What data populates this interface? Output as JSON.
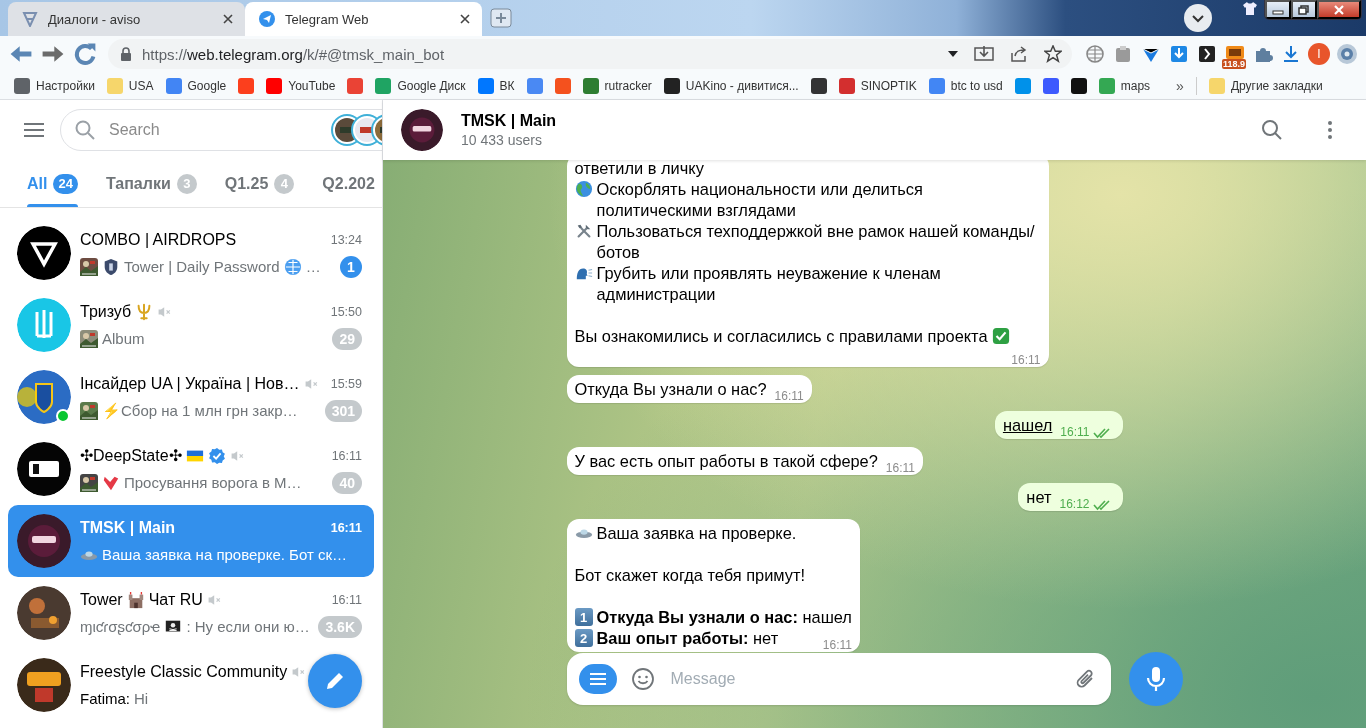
{
  "browser": {
    "tabs": [
      {
        "title": "Диалоги - aviso",
        "selected": false
      },
      {
        "title": "Telegram Web",
        "selected": true
      }
    ],
    "url": {
      "scheme": "https://",
      "host": "web.telegram.org",
      "path": "/k/#@tmsk_main_bot"
    },
    "extension_badge": "118.9",
    "profile_initial": "I",
    "bookmarks": [
      {
        "label": "Настройки",
        "color": "#5f6368"
      },
      {
        "label": "USA",
        "color": "#f6d66b"
      },
      {
        "label": "Google",
        "color": "#4285f4"
      },
      {
        "color": "#fc3f1d"
      },
      {
        "label": "YouTube",
        "color": "#ff0000"
      },
      {
        "color": "#ea4335"
      },
      {
        "label": "Google Диск",
        "color": "#1fa463"
      },
      {
        "label": "ВК",
        "color": "#0077ff"
      },
      {
        "color": "#4a89f3"
      },
      {
        "color": "#f4511e"
      },
      {
        "label": "rutracker",
        "color": "#2e7d32"
      },
      {
        "label": "UAKino - дивитися...",
        "color": "#222222"
      },
      {
        "color": "#333334"
      },
      {
        "label": "SINOPTIK",
        "color": "#d32f2f"
      },
      {
        "label": "btc to usd",
        "color": "#4286f4"
      },
      {
        "color": "#0091ea"
      },
      {
        "color": "#3d5afe"
      },
      {
        "color": "#111111"
      },
      {
        "label": "maps",
        "color": "#34a853"
      }
    ],
    "overflow": "»",
    "other_bookmarks": "Другие закладки"
  },
  "sidebar": {
    "search": {
      "placeholder": "Search"
    },
    "folders": [
      {
        "label": "All",
        "count": "24",
        "selected": true
      },
      {
        "label": "Тапалки",
        "count": "3",
        "selected": false
      },
      {
        "label": "Q1.25",
        "count": "4",
        "selected": false
      },
      {
        "label": "Q2.202",
        "selected": false
      }
    ],
    "chats": [
      {
        "name": [
          {
            "kind": "text",
            "text": "COMBO | AIRDROPS"
          }
        ],
        "muted": false,
        "verified": false,
        "online": false,
        "time": "13:24",
        "preview": [
          {
            "kind": "thumb"
          },
          {
            "kind": "icon"
          },
          {
            "kind": "text",
            "text": "Tower | Daily Password"
          },
          {
            "kind": "icon"
          },
          {
            "kind": "text",
            "text": "…"
          }
        ],
        "badge": "1",
        "selected": false,
        "color": "#000000"
      },
      {
        "name": [
          {
            "kind": "text",
            "text": "Тризуб"
          },
          {
            "kind": "icon"
          }
        ],
        "muted": true,
        "verified": false,
        "online": false,
        "time": "15:50",
        "preview": [
          {
            "kind": "thumb"
          },
          {
            "kind": "text",
            "text": "Album"
          }
        ],
        "badge": "29",
        "selected": false,
        "color": "#19c6e6"
      },
      {
        "name": [
          {
            "kind": "text",
            "text": "Інсайдер UA | Україна | Нов…"
          }
        ],
        "muted": true,
        "verified": false,
        "online": true,
        "time": "15:59",
        "preview": [
          {
            "kind": "thumb"
          },
          {
            "kind": "text",
            "text": "⚡Сбор на 1 млн грн закр…"
          }
        ],
        "badge": "301",
        "selected": false,
        "color": "#2b6cc4"
      },
      {
        "name": [
          {
            "kind": "text",
            "text": "✣DeepState✣"
          },
          {
            "kind": "icon"
          }
        ],
        "muted": true,
        "verified": true,
        "online": false,
        "time": "16:11",
        "preview": [
          {
            "kind": "thumb"
          },
          {
            "kind": "icon"
          },
          {
            "kind": "text",
            "text": "Просування ворога в М…"
          }
        ],
        "badge": "40",
        "selected": false,
        "color": "#050505"
      },
      {
        "name": [
          {
            "kind": "text",
            "text": "TMSK | Main"
          }
        ],
        "muted": false,
        "verified": false,
        "online": false,
        "time": "16:11",
        "preview": [
          {
            "kind": "icon"
          },
          {
            "kind": "text",
            "text": "Ваша заявка на проверке. Бот ск…"
          }
        ],
        "selected": true,
        "color": "#3a1a2a"
      },
      {
        "name": [
          {
            "kind": "text",
            "text": "Tower"
          },
          {
            "kind": "icon"
          },
          {
            "kind": "text",
            "text": "Чат RU"
          }
        ],
        "muted": true,
        "verified": false,
        "online": false,
        "time": "16:11",
        "preview": [
          {
            "kind": "text",
            "text": "ɱιƈɾσʂƈσρҽ"
          },
          {
            "kind": "icon"
          },
          {
            "kind": "text",
            "text": ": Ну если они ю…"
          }
        ],
        "badge": "3.6K",
        "selected": false,
        "color": "#4a3a30"
      },
      {
        "name": [
          {
            "kind": "text",
            "text": "Freestyle Classic Community"
          }
        ],
        "muted": true,
        "verified": false,
        "online": false,
        "preview": [
          {
            "kind": "sender",
            "text": "Fatima:"
          },
          {
            "kind": "text",
            "text": "Hi"
          }
        ],
        "selected": false,
        "color": "#3a2a1a"
      }
    ]
  },
  "chat": {
    "title": "TMSK | Main",
    "subtitle": "10 433 users",
    "messages": [
      {
        "kind": "in",
        "paragraphs": [
          {
            "kind": "plain",
            "text": "ответили в личку"
          },
          {
            "kind": "emoji",
            "text": "Оскорблять национальности или делиться политическими взглядами"
          },
          {
            "kind": "emoji",
            "text": "Пользоваться техподдержкой вне рамок нашей команды/ботов"
          },
          {
            "kind": "emoji",
            "text": "Грубить или проявлять неуважение к членам администрации"
          },
          {
            "kind": "emoji_after",
            "spaced": true,
            "text": "Вы ознакомились и согласились с правилами проекта"
          }
        ],
        "time": "16:11"
      },
      {
        "kind": "in",
        "paragraphs": [
          {
            "kind": "plain",
            "text": "Откуда Вы узнали о нас?"
          }
        ],
        "time": "16:11"
      },
      {
        "kind": "out",
        "underlined": true,
        "paragraphs": [
          {
            "kind": "plain",
            "text": "нашел"
          }
        ],
        "time": "16:11",
        "read": true
      },
      {
        "kind": "in",
        "paragraphs": [
          {
            "kind": "plain",
            "text": "У вас есть опыт работы в такой сфере?"
          }
        ],
        "time": "16:11"
      },
      {
        "kind": "out",
        "underlined": false,
        "paragraphs": [
          {
            "kind": "plain",
            "text": "нет"
          }
        ],
        "time": "16:12",
        "read": true
      },
      {
        "kind": "in",
        "paragraphs": [
          {
            "kind": "emoji",
            "text": "Ваша заявка на проверке."
          },
          {
            "kind": "plain",
            "spaced": true,
            "text": "Бот скажет когда тебя примут!"
          },
          {
            "kind": "keycap",
            "spaced": true,
            "keycap": "1",
            "text": "**Откуда Вы узнали о нас:** нашел"
          },
          {
            "kind": "keycap",
            "keycap": "2",
            "text": "**Ваш опыт работы:** нет"
          }
        ],
        "time": "16:11"
      }
    ],
    "composer": {
      "placeholder": "Message"
    }
  }
}
